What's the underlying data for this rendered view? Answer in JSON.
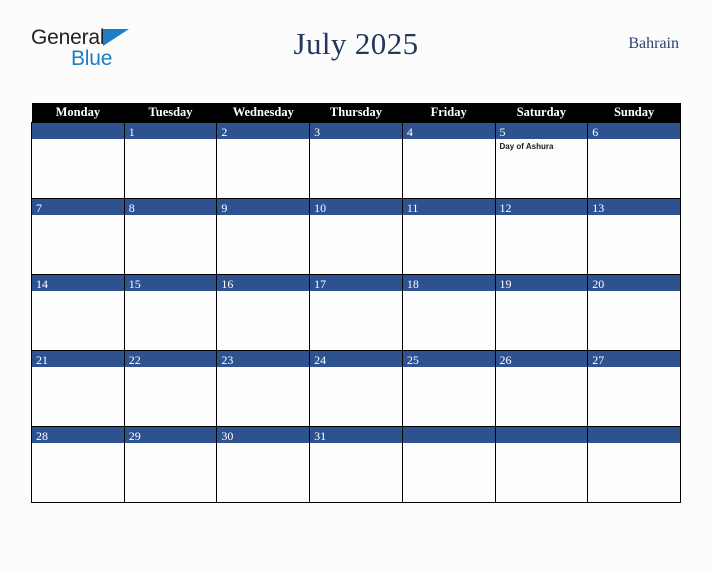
{
  "brand": {
    "name_part1": "General",
    "name_part2": "Blue",
    "triangle_color": "#1f7dc4",
    "text_color": "#231f20"
  },
  "header": {
    "title": "July 2025",
    "country": "Bahrain",
    "title_color": "#24385e",
    "country_color": "#2c4370"
  },
  "calendar": {
    "accent_color": "#2e5190",
    "header_bg": "#000000",
    "weekday_headers": [
      "Monday",
      "Tuesday",
      "Wednesday",
      "Thursday",
      "Friday",
      "Saturday",
      "Sunday"
    ],
    "weeks": [
      [
        {
          "day": "",
          "events": []
        },
        {
          "day": "1",
          "events": []
        },
        {
          "day": "2",
          "events": []
        },
        {
          "day": "3",
          "events": []
        },
        {
          "day": "4",
          "events": []
        },
        {
          "day": "5",
          "events": [
            "Day of Ashura"
          ]
        },
        {
          "day": "6",
          "events": []
        }
      ],
      [
        {
          "day": "7",
          "events": []
        },
        {
          "day": "8",
          "events": []
        },
        {
          "day": "9",
          "events": []
        },
        {
          "day": "10",
          "events": []
        },
        {
          "day": "11",
          "events": []
        },
        {
          "day": "12",
          "events": []
        },
        {
          "day": "13",
          "events": []
        }
      ],
      [
        {
          "day": "14",
          "events": []
        },
        {
          "day": "15",
          "events": []
        },
        {
          "day": "16",
          "events": []
        },
        {
          "day": "17",
          "events": []
        },
        {
          "day": "18",
          "events": []
        },
        {
          "day": "19",
          "events": []
        },
        {
          "day": "20",
          "events": []
        }
      ],
      [
        {
          "day": "21",
          "events": []
        },
        {
          "day": "22",
          "events": []
        },
        {
          "day": "23",
          "events": []
        },
        {
          "day": "24",
          "events": []
        },
        {
          "day": "25",
          "events": []
        },
        {
          "day": "26",
          "events": []
        },
        {
          "day": "27",
          "events": []
        }
      ],
      [
        {
          "day": "28",
          "events": []
        },
        {
          "day": "29",
          "events": []
        },
        {
          "day": "30",
          "events": []
        },
        {
          "day": "31",
          "events": []
        },
        {
          "day": "",
          "events": []
        },
        {
          "day": "",
          "events": []
        },
        {
          "day": "",
          "events": []
        }
      ]
    ]
  }
}
